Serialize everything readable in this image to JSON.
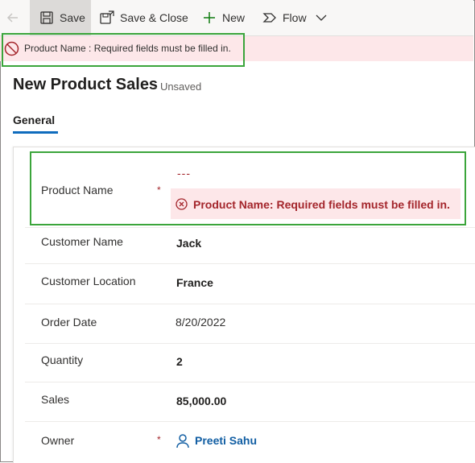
{
  "toolbar": {
    "save_label": "Save",
    "save_close_label": "Save & Close",
    "new_label": "New",
    "flow_label": "Flow"
  },
  "notification": {
    "message": "Product Name : Required fields must be filled in."
  },
  "header": {
    "title": "New Product Sales",
    "status": "- Unsaved"
  },
  "tabs": [
    {
      "label": "General",
      "selected": true
    }
  ],
  "form": {
    "product_name": {
      "label": "Product Name",
      "required_mark": "*",
      "value": "---",
      "error": "Product Name: Required fields must be filled in."
    },
    "customer_name": {
      "label": "Customer Name",
      "value": "Jack"
    },
    "customer_location": {
      "label": "Customer Location",
      "value": "France"
    },
    "order_date": {
      "label": "Order Date",
      "value": "8/20/2022"
    },
    "quantity": {
      "label": "Quantity",
      "value": "2"
    },
    "sales": {
      "label": "Sales",
      "value": "85,000.00"
    },
    "owner": {
      "label": "Owner",
      "required_mark": "*",
      "value": "Preeti Sahu"
    }
  },
  "colors": {
    "error_red": "#a4262c",
    "error_bg": "#fde7e9",
    "highlight_green": "#3ba53b",
    "link_blue": "#115ea3",
    "tab_accent": "#0f6cbd"
  },
  "icons": {
    "back": "back-arrow-icon",
    "save": "floppy-disk-icon",
    "save_close": "save-close-icon",
    "new": "plus-icon",
    "flow": "flow-icon",
    "more": "chevron-down-icon",
    "notification": "blocked-circle-icon",
    "field_error": "error-circle-icon",
    "owner": "person-icon"
  }
}
